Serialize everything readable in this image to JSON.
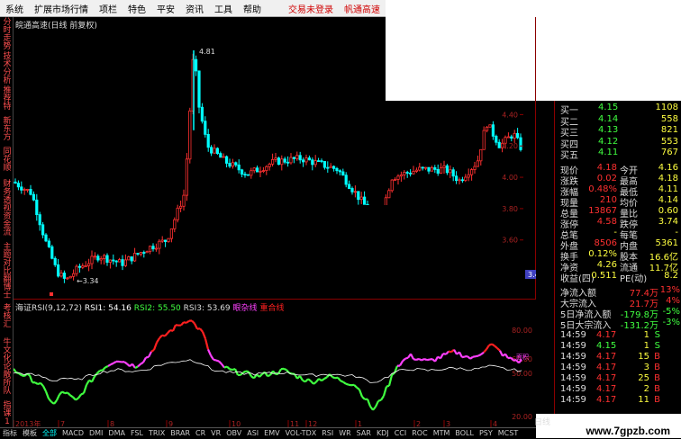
{
  "menu": {
    "items": [
      "系统",
      "扩展市场行情",
      "项栏",
      "特色",
      "平安",
      "资讯",
      "工具",
      "帮助"
    ],
    "trade_status": "交易未登录",
    "stock_name_right": "帆通高速"
  },
  "sidebar": {
    "items": [
      "分时走势",
      "技术分析",
      "推荐特",
      "新东方",
      "同花顺",
      "财务透视",
      "资金流",
      "主题对比",
      "翻博士",
      "考核汇",
      "牛文化论",
      "散所队",
      "指课1"
    ]
  },
  "chart": {
    "title": "皖通高速(日线 前复权)",
    "high_label": "4.81",
    "low_label": "←3.34",
    "right_axis": [
      "4.40",
      "4.20",
      "4.00",
      "3.80",
      "3.60",
      "3.41"
    ],
    "current_price_tag": "3.41"
  },
  "rsi": {
    "title_prefix": "海证RSI(9,12,72)",
    "rsi1": "RSI1: 54.16",
    "rsi2": "RSI2: 55.50",
    "rsi3": "RSI3: 53.69",
    "legend1": "眼杂线",
    "legend2": "重合线",
    "axis": [
      "80.00",
      "60.00",
      "50.00",
      "20.00"
    ],
    "tag": "面积"
  },
  "xaxis": {
    "labels": [
      "2013年",
      "7",
      "8",
      "9",
      "10",
      "11",
      "12",
      "1",
      "2",
      "3",
      "4"
    ]
  },
  "bottombar": {
    "items": [
      "指标",
      "模板",
      "全部",
      "MACD",
      "DMI",
      "DMA",
      "FSL",
      "TRIX",
      "BRAR",
      "CR",
      "VR",
      "OBV",
      "ASI",
      "EMV",
      "VOL-TDX",
      "RSI",
      "WR",
      "SAR",
      "KDJ",
      "CCI",
      "ROC",
      "MTM",
      "BOLL",
      "PSY",
      "MCST"
    ],
    "selected": "全部"
  },
  "quote": {
    "orderbook": [
      {
        "label": "买一",
        "price": "4.15",
        "vol": "1108"
      },
      {
        "label": "买二",
        "price": "4.14",
        "vol": "558"
      },
      {
        "label": "买三",
        "price": "4.13",
        "vol": "821"
      },
      {
        "label": "买四",
        "price": "4.12",
        "vol": "553"
      },
      {
        "label": "买五",
        "price": "4.11",
        "vol": "767"
      }
    ],
    "stats": [
      {
        "l1": "现价",
        "v1": "4.18",
        "l2": "今开",
        "v2": "4.16"
      },
      {
        "l1": "涨跌",
        "v1": "0.02",
        "l2": "最高",
        "v2": "4.18"
      },
      {
        "l1": "涨幅",
        "v1": "0.48%",
        "l2": "最低",
        "v2": "4.11"
      },
      {
        "l1": "现量",
        "v1": "210",
        "l2": "均价",
        "v2": "4.14"
      },
      {
        "l1": "总量",
        "v1": "13867",
        "l2": "量比",
        "v2": "0.60"
      },
      {
        "l1": "涨停",
        "v1": "4.58",
        "l2": "跌停",
        "v2": "3.74"
      },
      {
        "l1": "总笔",
        "v1": "-",
        "l2": "每笔",
        "v2": "-"
      },
      {
        "l1": "外盘",
        "v1": "8506",
        "l2": "内盘",
        "v2": "5361"
      },
      {
        "l1": "换手",
        "v1": "0.12%",
        "l2": "股本",
        "v2": "16.6亿"
      },
      {
        "l1": "净资",
        "v1": "4.26",
        "l2": "流通",
        "v2": "11.7亿"
      },
      {
        "l1": "收益(四)",
        "v1": "0.511",
        "l2": "PE(动)",
        "v2": "8.2"
      }
    ],
    "flows": [
      {
        "label": "净流入额",
        "value": "77.4万",
        "pct": "13%"
      },
      {
        "label": "大宗流入",
        "value": "21.7万",
        "pct": "4%"
      },
      {
        "label": "5日净流入额",
        "value": "-179.8万",
        "pct": "-5%"
      },
      {
        "label": "5日大宗流入",
        "value": "-131.2万",
        "pct": "-3%"
      }
    ],
    "ticks": [
      {
        "time": "14:59",
        "price": "4.17",
        "vol": "1",
        "side": "S"
      },
      {
        "time": "14:59",
        "price": "4.15",
        "vol": "1",
        "side": "S"
      },
      {
        "time": "14:59",
        "price": "4.17",
        "vol": "15",
        "side": "B"
      },
      {
        "time": "14:59",
        "price": "4.17",
        "vol": "3",
        "side": "B"
      },
      {
        "time": "14:59",
        "price": "4.17",
        "vol": "25",
        "side": "B"
      },
      {
        "time": "14:59",
        "price": "4.17",
        "vol": "2",
        "side": "B"
      },
      {
        "time": "14:59",
        "price": "4.17",
        "vol": "11",
        "side": "B"
      }
    ],
    "day_label": "日线"
  },
  "watermark": "www.7gpzb.com",
  "colors": {
    "up": "#ff3030",
    "down": "#00ffff",
    "rsi_red": "#ff2020",
    "rsi_magenta": "#ff40ff",
    "rsi_green": "#40ff40",
    "rsi_white": "#ffffff"
  }
}
